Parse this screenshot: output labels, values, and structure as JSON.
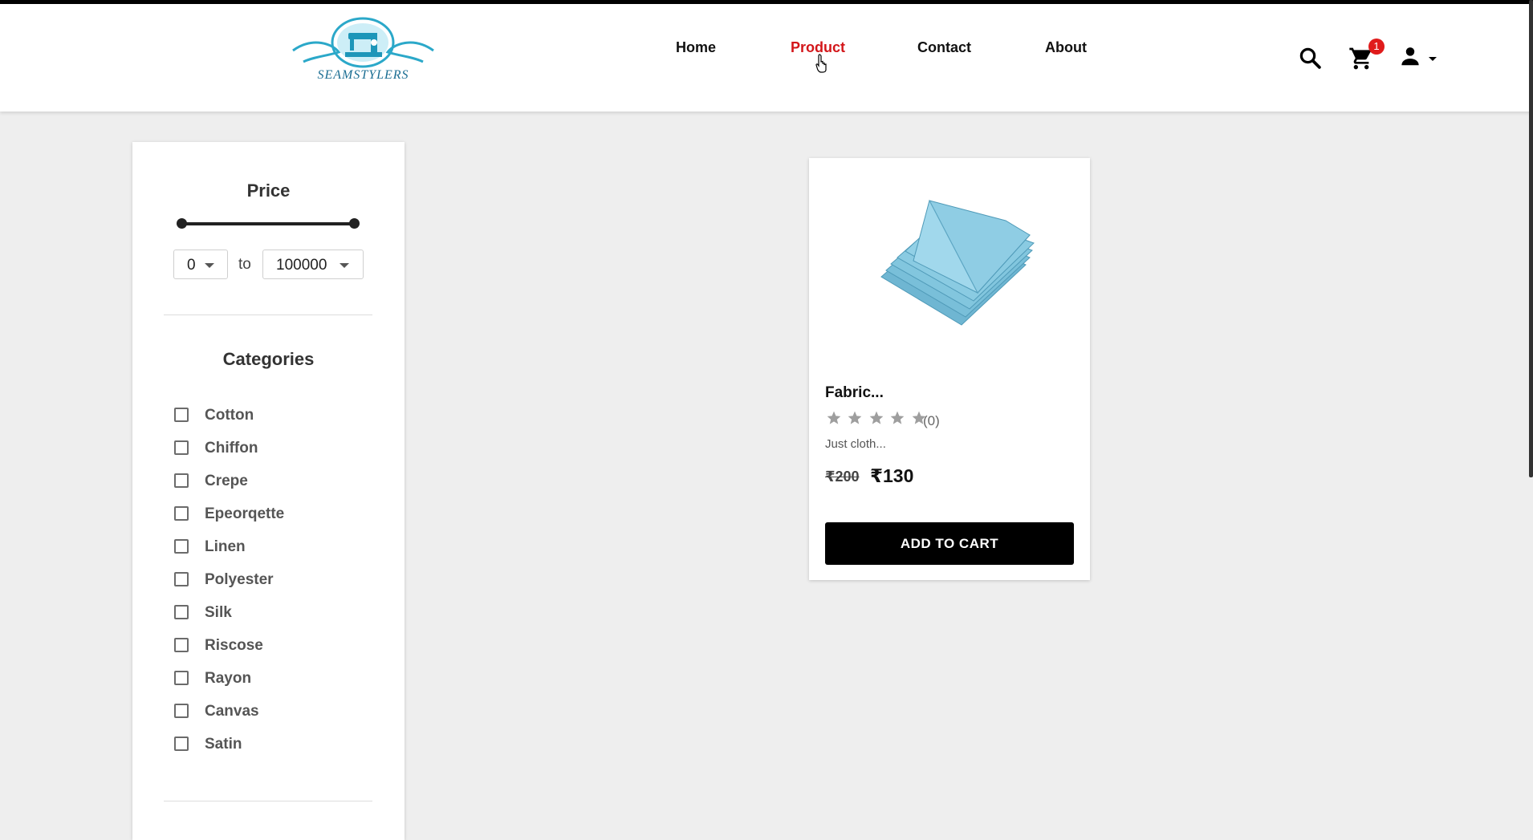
{
  "brand": {
    "logo_text": "SEAMSTYLERS"
  },
  "nav": {
    "items": [
      {
        "label": "Home",
        "active": false
      },
      {
        "label": "Product",
        "active": true
      },
      {
        "label": "Contact",
        "active": false
      },
      {
        "label": "About",
        "active": false
      }
    ]
  },
  "header_icons": {
    "search": "search-icon",
    "cart": "cart-icon",
    "cart_count": "1",
    "account": "user-icon"
  },
  "filters": {
    "price": {
      "title": "Price",
      "min_value": "0",
      "to_label": "to",
      "max_value": "100000"
    },
    "categories": {
      "title": "Categories",
      "items": [
        "Cotton",
        "Chiffon",
        "Crepe",
        "Epeorqette",
        "Linen",
        "Polyester",
        "Silk",
        "Riscose",
        "Rayon",
        "Canvas",
        "Satin"
      ]
    }
  },
  "products": [
    {
      "name": "Fabric...",
      "rating": 0,
      "review_count": "(0)",
      "description": "Just cloth...",
      "old_price": "₹200",
      "price": "₹130",
      "button_label": "ADD TO CART"
    }
  ],
  "colors": {
    "accent": "#d3161a",
    "badge": "#e01b1b",
    "button": "#000000",
    "fabric": "#7ec3dc"
  }
}
